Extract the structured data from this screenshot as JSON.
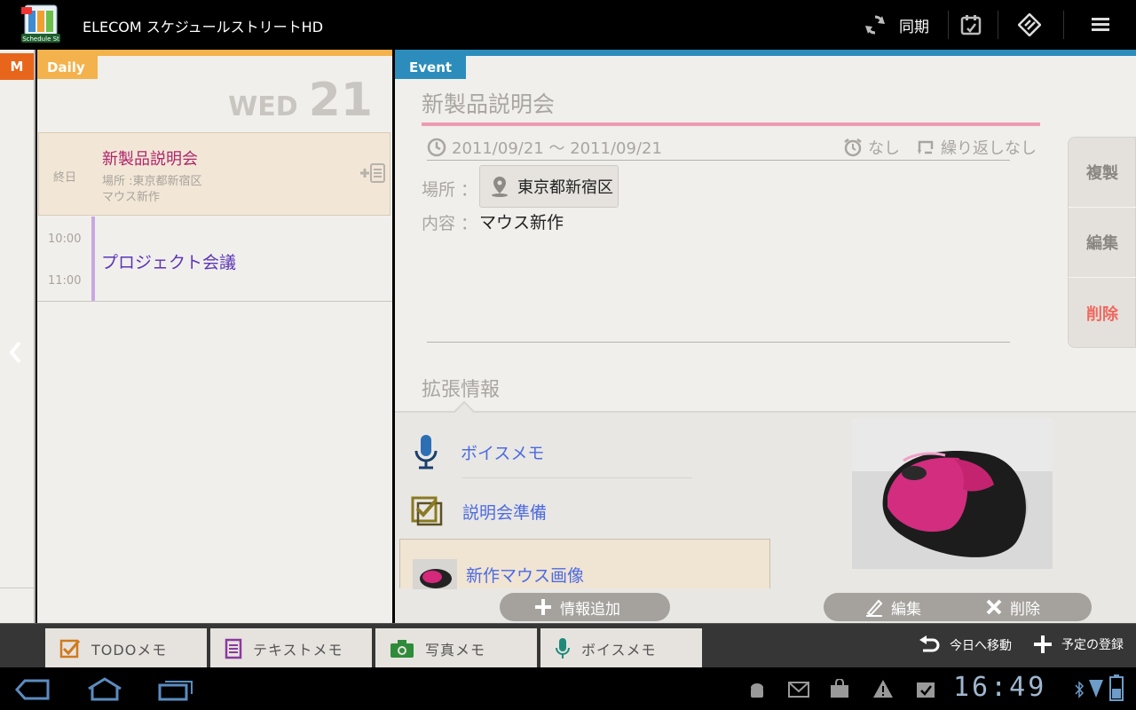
{
  "app": {
    "title": "ELECOM スケジュールストリートHD",
    "icon_label": "Schedule St",
    "sync_label": "同期"
  },
  "month_tab": "M",
  "daily": {
    "tab_label": "Daily",
    "weekday": "WED",
    "day": "21",
    "allday_event": {
      "label": "終日",
      "title": "新製品説明会",
      "location": "場所 :東京都新宿区",
      "content": "マウス新作"
    },
    "timed_event": {
      "start": "10:00",
      "end": "11:00",
      "title": "プロジェクト会議"
    }
  },
  "event": {
    "tab_label": "Event",
    "title": "新製品説明会",
    "date_range": "2011/09/21 〜 2011/09/21",
    "alarm": "なし",
    "repeat": "繰り返しなし",
    "location_label": "場所 ：",
    "location": "東京都新宿区",
    "content_label": "内容 ：",
    "content": "マウス新作",
    "side_actions": {
      "duplicate": "複製",
      "edit": "編集",
      "delete": "削除"
    },
    "extended": {
      "title": "拡張情報",
      "items": [
        {
          "label": "ボイスメモ",
          "icon": "microphone-icon"
        },
        {
          "label": "説明会準備",
          "icon": "todo-checkbox-icon"
        },
        {
          "label": "新作マウス画像",
          "icon": "photo-thumbnail"
        }
      ],
      "add_info": "情報追加",
      "edit": "編集",
      "delete": "削除"
    }
  },
  "bottom_tabs": [
    {
      "label": "TODOメモ",
      "icon": "todo-icon"
    },
    {
      "label": "テキストメモ",
      "icon": "text-memo-icon"
    },
    {
      "label": "写真メモ",
      "icon": "camera-icon"
    },
    {
      "label": "ボイスメモ",
      "icon": "microphone-icon"
    }
  ],
  "bottom_actions": {
    "go_today": "今日へ移動",
    "add_event": "予定の登録"
  },
  "status": {
    "clock": "16:49"
  },
  "colors": {
    "daily_accent": "#f3b24c",
    "event_accent": "#2c8dbc",
    "month_accent": "#e8661b",
    "delete_red": "#f0685e",
    "link_blue": "#4d6be0"
  }
}
